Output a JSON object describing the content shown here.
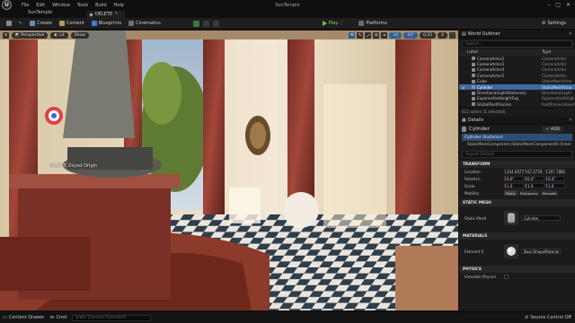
{
  "title_bar": {
    "menu": [
      "File",
      "Edit",
      "Window",
      "Tools",
      "Build",
      "Help"
    ],
    "app_title": "SunTemple",
    "project_tab": "SunTemple"
  },
  "tab_bar": {
    "level_tab": "DELETE"
  },
  "toolbar": {
    "save_icon": "save-icon",
    "create": "Create",
    "content": "Content",
    "blueprints": "Blueprints",
    "cinematics": "Cinematics",
    "play": "Play",
    "platforms": "Platforms",
    "settings": "Settings"
  },
  "viewport": {
    "perspective": "Perspective",
    "lit": "Lit",
    "show": "Show",
    "grid_snap": "10",
    "rot_snap": "10°",
    "scale_snap": "0.25",
    "cam_speed": "4"
  },
  "world_outliner": {
    "title": "World Outliner",
    "search_placeholder": "Search...",
    "col_label": "Label",
    "col_type": "Type",
    "rows": [
      {
        "label": "CameraActor2",
        "type": "CameraActor"
      },
      {
        "label": "CameraActor3",
        "type": "CameraActor"
      },
      {
        "label": "CameraActor4",
        "type": "CameraActor"
      },
      {
        "label": "CameraActor5",
        "type": "CameraActor"
      },
      {
        "label": "Cube",
        "type": "StaticMeshActor"
      },
      {
        "label": "Cylinder",
        "type": "StaticMeshActor"
      },
      {
        "label": "DirectionalLightStationary",
        "type": "DirectionalLight"
      },
      {
        "label": "ExponentialHeightFog",
        "type": "ExponentialHeightFog"
      },
      {
        "label": "GlobalPostProcess",
        "type": "PostProcessVolume"
      }
    ],
    "footer": "612 actors (1 selected)"
  },
  "details": {
    "title": "Details",
    "actor_name": "Cylinder",
    "add_label": "ADD",
    "root_component": "Cylinder (Instance)",
    "child_component": "StaticMeshComponent (StaticMeshComponent0) (Inher",
    "search_placeholder": "Search Details",
    "transform": {
      "header": "TRANSFORM",
      "location_label": "Location",
      "location": [
        "204.6977",
        "67.6759",
        "397.7881"
      ],
      "rotation_label": "Rotation",
      "rotation": [
        "0.0°",
        "0.0°",
        "0.0°"
      ],
      "scale_label": "Scale",
      "scale": [
        "1.0",
        "1.0",
        "1.0"
      ],
      "mobility_label": "Mobility",
      "mobility": [
        "Static",
        "Stationary",
        "Movable"
      ]
    },
    "static_mesh": {
      "header": "STATIC MESH",
      "label": "Static Mesh",
      "value": "Cylinder"
    },
    "materials": {
      "header": "MATERIALS",
      "label": "Element 0",
      "value": "BasicShapeMaterial"
    },
    "physics": {
      "header": "PHYSICS",
      "simulate_label": "Simulate Physics"
    }
  },
  "status_bar": {
    "content_drawer": "Content Drawer",
    "cmd": "Cmd",
    "cmd_placeholder": "Enter Console Command",
    "source_control": "Source Control Off"
  },
  "viewport_overlay_text": [
    "DELETE",
    "Zeyed Origin"
  ]
}
